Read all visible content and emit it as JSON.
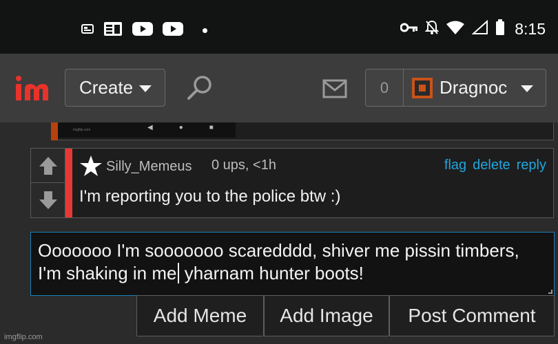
{
  "status_bar": {
    "time": "8:15",
    "left_icons": [
      "news-icon",
      "google-news-icon",
      "youtube-icon",
      "youtube-icon",
      "dot-icon"
    ],
    "right_icons": [
      "vpn-key-icon",
      "bell-off-icon",
      "wifi-icon",
      "signal-icon",
      "battery-icon"
    ]
  },
  "navbar": {
    "logo_text": "im",
    "create_label": "Create",
    "notification_count": "0",
    "username": "Dragnoc"
  },
  "colors": {
    "accent_blue": "#22a6dd",
    "downvote_bar": "#e53935",
    "logo_red": "#e8322a",
    "avatar_orange": "#c9531a"
  },
  "previous_strip": {
    "tiny_text": "imgflip.com"
  },
  "comment": {
    "username": "Silly_Memeus",
    "meta": "0 ups, <1h",
    "actions": [
      "flag",
      "delete",
      "reply"
    ],
    "text": "I'm reporting you to the police btw :)"
  },
  "reply": {
    "text_before_caret": "Ooooooo I'm sooooooo scaredddd, shiver me pissin timbers, I'm shaking in me",
    "text_after_caret": " yharnam hunter boots!"
  },
  "buttons": {
    "add_meme": "Add Meme",
    "add_image": "Add Image",
    "post_comment": "Post Comment"
  },
  "watermark": "imgflip.com"
}
